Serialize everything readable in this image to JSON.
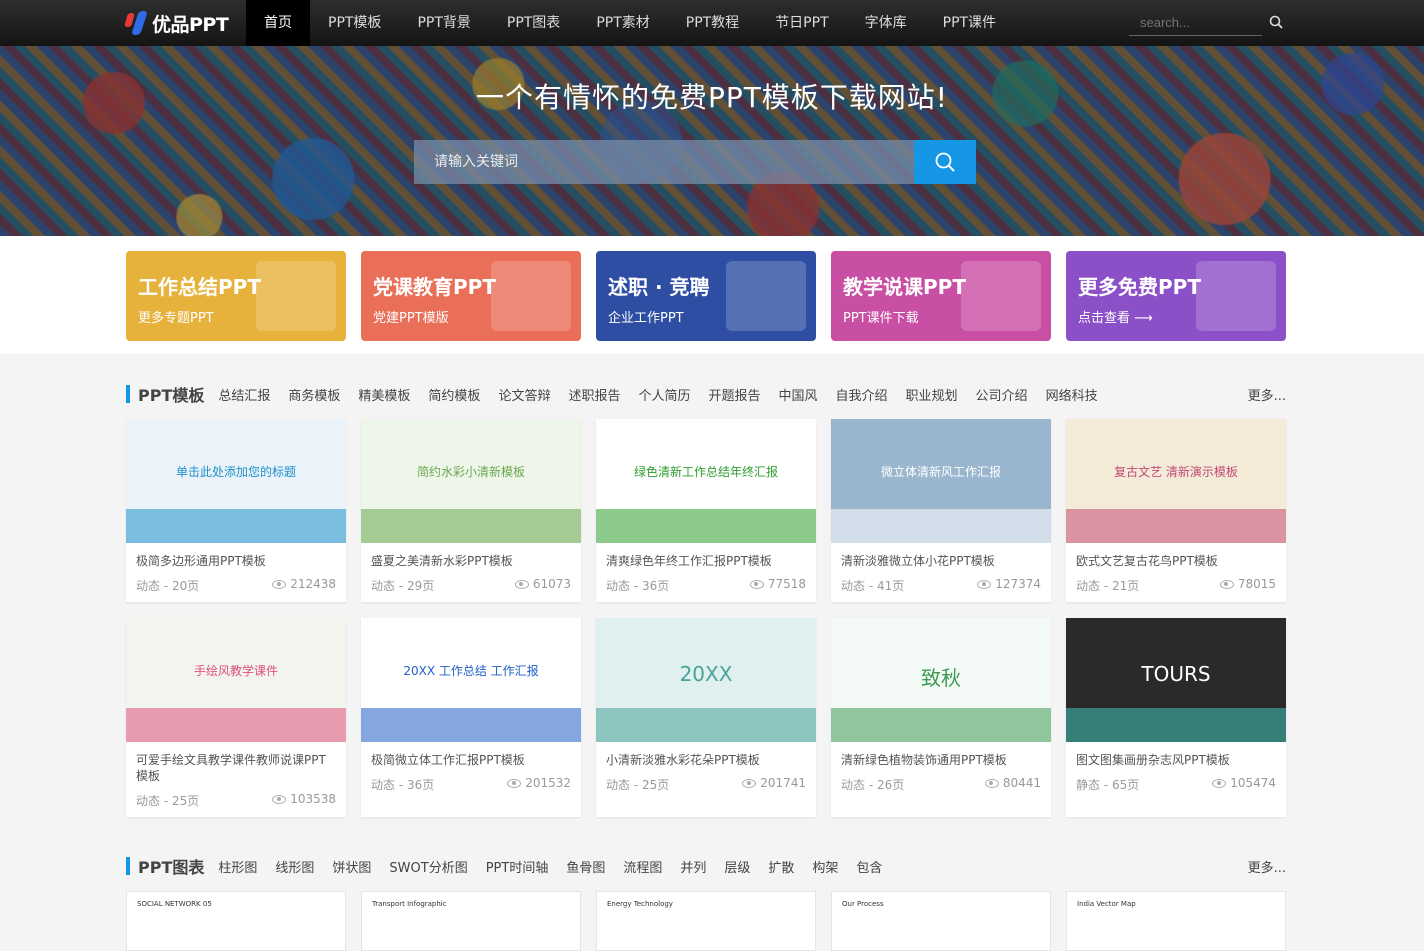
{
  "header": {
    "logo_text": "优品PPT",
    "nav": [
      "首页",
      "PPT模板",
      "PPT背景",
      "PPT图表",
      "PPT素材",
      "PPT教程",
      "节日PPT",
      "字体库",
      "PPT课件"
    ],
    "active_index": 0,
    "search_placeholder": "search..."
  },
  "hero": {
    "title": "一个有情怀的免费PPT模板下载网站!",
    "search_placeholder": "请输入关键词"
  },
  "banners": [
    {
      "title": "工作总结PPT",
      "sub": "更多专题PPT",
      "color": "#e7b23c"
    },
    {
      "title": "党课教育PPT",
      "sub": "党建PPT模版",
      "color": "#ea6f58"
    },
    {
      "title": "述职 · 竞聘",
      "sub": "企业工作PPT",
      "color": "#2d4ea3"
    },
    {
      "title": "教学说课PPT",
      "sub": "PPT课件下载",
      "color": "#c94fa5"
    },
    {
      "title": "更多免费PPT",
      "sub": "点击查看 ⟶",
      "color": "#8b4fc8"
    }
  ],
  "templates_section": {
    "title": "PPT模板",
    "tags": [
      "总结汇报",
      "商务模板",
      "精美模板",
      "简约模板",
      "论文答辩",
      "述职报告",
      "个人简历",
      "开题报告",
      "中国风",
      "自我介绍",
      "职业规划",
      "公司介绍",
      "网络科技"
    ],
    "more": "更多...",
    "cards": [
      {
        "title": "极简多边形通用PPT模板",
        "meta": "动态 - 20页",
        "views": "212438",
        "thumb_text": "单击此处添加您的标题",
        "bg": "#eaf3fa",
        "accent": "#1e8fc8"
      },
      {
        "title": "盛夏之美清新水彩PPT模板",
        "meta": "动态 - 29页",
        "views": "61073",
        "thumb_text": "简约水彩小清新模板",
        "bg": "#eef6ea",
        "accent": "#6aa84f"
      },
      {
        "title": "清爽绿色年终工作汇报PPT模板",
        "meta": "动态 - 36页",
        "views": "77518",
        "thumb_text": "绿色清新工作总结年终汇报",
        "bg": "#ffffff",
        "accent": "#2e9e2e"
      },
      {
        "title": "清新淡雅微立体小花PPT模板",
        "meta": "动态 - 41页",
        "views": "127374",
        "thumb_text": "微立体清新风工作汇报",
        "bg": "#9ab6cf",
        "accent": "#ffffff"
      },
      {
        "title": "欧式文艺复古花鸟PPT模板",
        "meta": "动态 - 21页",
        "views": "78015",
        "thumb_text": "复古文艺 清新演示模板",
        "bg": "#f3ead8",
        "accent": "#c24b74"
      },
      {
        "title": "可爱手绘文具教学课件教师说课PPT模板",
        "meta": "动态 - 25页",
        "views": "103538",
        "thumb_text": "手绘风教学课件",
        "bg": "#f2f5ee",
        "accent": "#e0507a"
      },
      {
        "title": "极简微立体工作汇报PPT模板",
        "meta": "动态 - 36页",
        "views": "201532",
        "thumb_text": "20XX 工作总结 工作汇报",
        "bg": "#ffffff",
        "accent": "#1f5fc8"
      },
      {
        "title": "小清新淡雅水彩花朵PPT模板",
        "meta": "动态 - 25页",
        "views": "201741",
        "thumb_text": "20XX",
        "bg": "#dff0ee",
        "accent": "#4aa39a"
      },
      {
        "title": "清新绿色植物装饰通用PPT模板",
        "meta": "动态 - 26页",
        "views": "80441",
        "thumb_text": "致秋",
        "bg": "#f4faf6",
        "accent": "#3c9a55"
      },
      {
        "title": "图文图集画册杂志风PPT模板",
        "meta": "静态 - 65页",
        "views": "105474",
        "thumb_text": "TOURS",
        "bg": "#2a2a2a",
        "accent": "#3fc3b8"
      }
    ]
  },
  "charts_section": {
    "title": "PPT图表",
    "tags": [
      "柱形图",
      "线形图",
      "饼状图",
      "SWOT分析图",
      "PPT时间轴",
      "鱼骨图",
      "流程图",
      "并列",
      "层级",
      "扩散",
      "构架",
      "包含"
    ],
    "more": "更多...",
    "thumbs": [
      "SOCIAL NETWORK 05",
      "Transport Infographic",
      "Energy Technology",
      "Our Process",
      "India Vector Map"
    ]
  }
}
